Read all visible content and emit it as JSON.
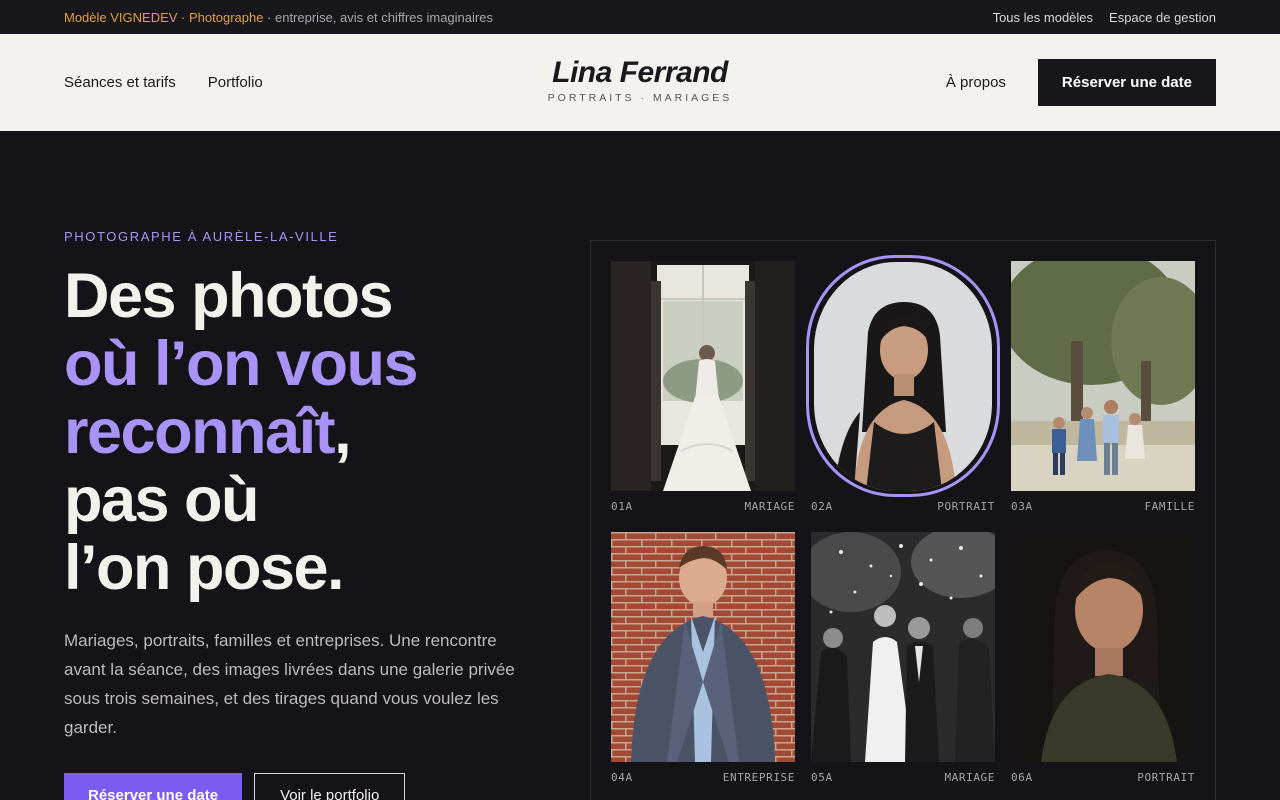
{
  "topbar": {
    "brand": "Modèle VIGNEDEV · Photographe",
    "note": " · entreprise, avis et chiffres imaginaires",
    "links": [
      "Tous les modèles",
      "Espace de gestion"
    ]
  },
  "header": {
    "nav_left": [
      "Séances et tarifs",
      "Portfolio"
    ],
    "brand_name": "Lina Ferrand",
    "brand_tag": "PORTRAITS · MARIAGES",
    "about": "À propos",
    "cta": "Réserver une date"
  },
  "hero": {
    "eyebrow": "PHOTOGRAPHE À AURÈLE-LA-VILLE",
    "headline_1": "Des photos",
    "headline_2": "où l’on vous",
    "headline_3": "reconnaît",
    "headline_3_comma": ",",
    "headline_4": "pas où",
    "headline_5": "l’on pose.",
    "lead": "Mariages, portraits, familles et entreprises. Une rencontre avant la séance, des images livrées dans une galerie privée sous trois semaines, et des tirages quand vous voulez les garder.",
    "primary_button": "Réserver une date",
    "secondary_button": "Voir le portfolio"
  },
  "gallery": [
    {
      "code": "01A",
      "label": "MARIAGE"
    },
    {
      "code": "02A",
      "label": "PORTRAIT"
    },
    {
      "code": "03A",
      "label": "FAMILLE"
    },
    {
      "code": "04A",
      "label": "ENTREPRISE"
    },
    {
      "code": "05A",
      "label": "MARIAGE"
    },
    {
      "code": "06A",
      "label": "PORTRAIT"
    }
  ],
  "colors": {
    "accent": "#a993f7",
    "button": "#7b5cf0",
    "topbar_brand": "#e0a13a",
    "background": "#141317",
    "header": "#f4f2ee"
  }
}
